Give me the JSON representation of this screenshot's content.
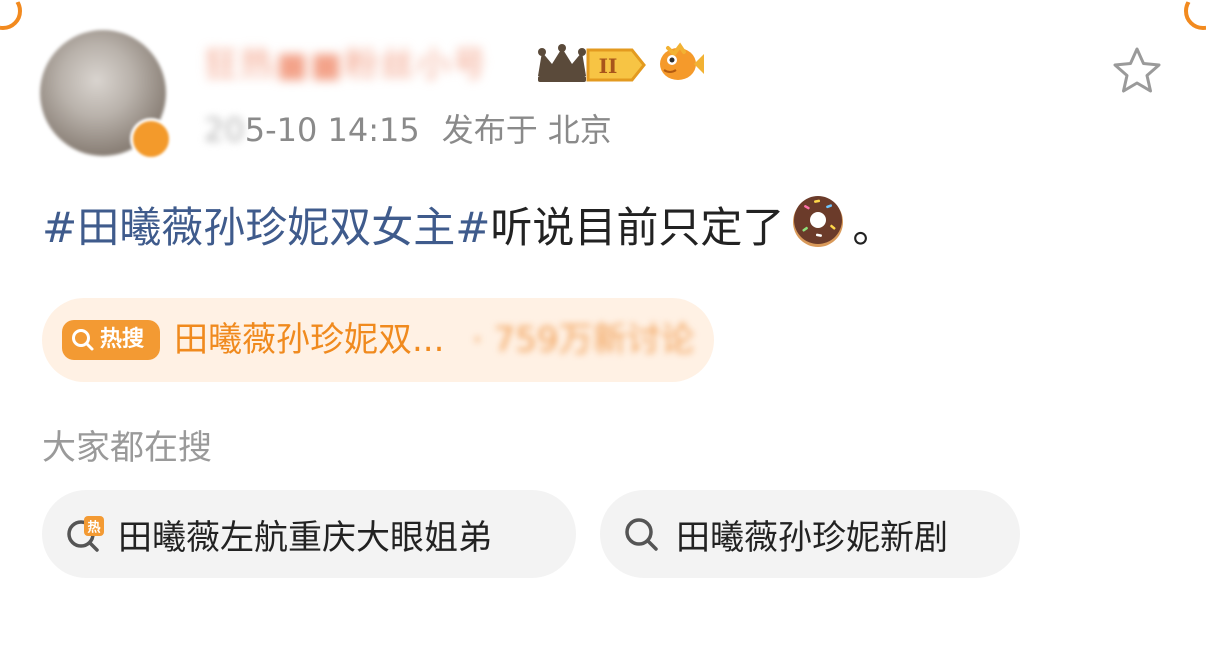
{
  "post": {
    "username": "狂热■■粉丝小号",
    "meta": {
      "date_prefix_blurred": "20",
      "date_time": "5-10 14:15",
      "location_label": "发布于",
      "location": "北京"
    },
    "body": {
      "topic": "#田曦薇孙珍妮双女主#",
      "text": "听说目前只定了",
      "suffix": "。"
    }
  },
  "hot_search": {
    "badge_label": "热搜",
    "title": "田曦薇孙珍妮双...",
    "stat_blurred": "· 759万新讨论"
  },
  "related": {
    "title": "大家都在搜",
    "chips": [
      {
        "label": "田曦薇左航重庆大眼姐弟",
        "icon": "hot-search-icon"
      },
      {
        "label": "田曦薇孙珍妮新剧",
        "icon": "search-icon"
      }
    ]
  },
  "colors": {
    "topic_link": "#3f5b8c",
    "hot_orange": "#f39a33",
    "hot_pill_bg": "#fff1e4",
    "chip_bg": "#f3f3f3",
    "meta_gray": "#8a8a8a"
  }
}
